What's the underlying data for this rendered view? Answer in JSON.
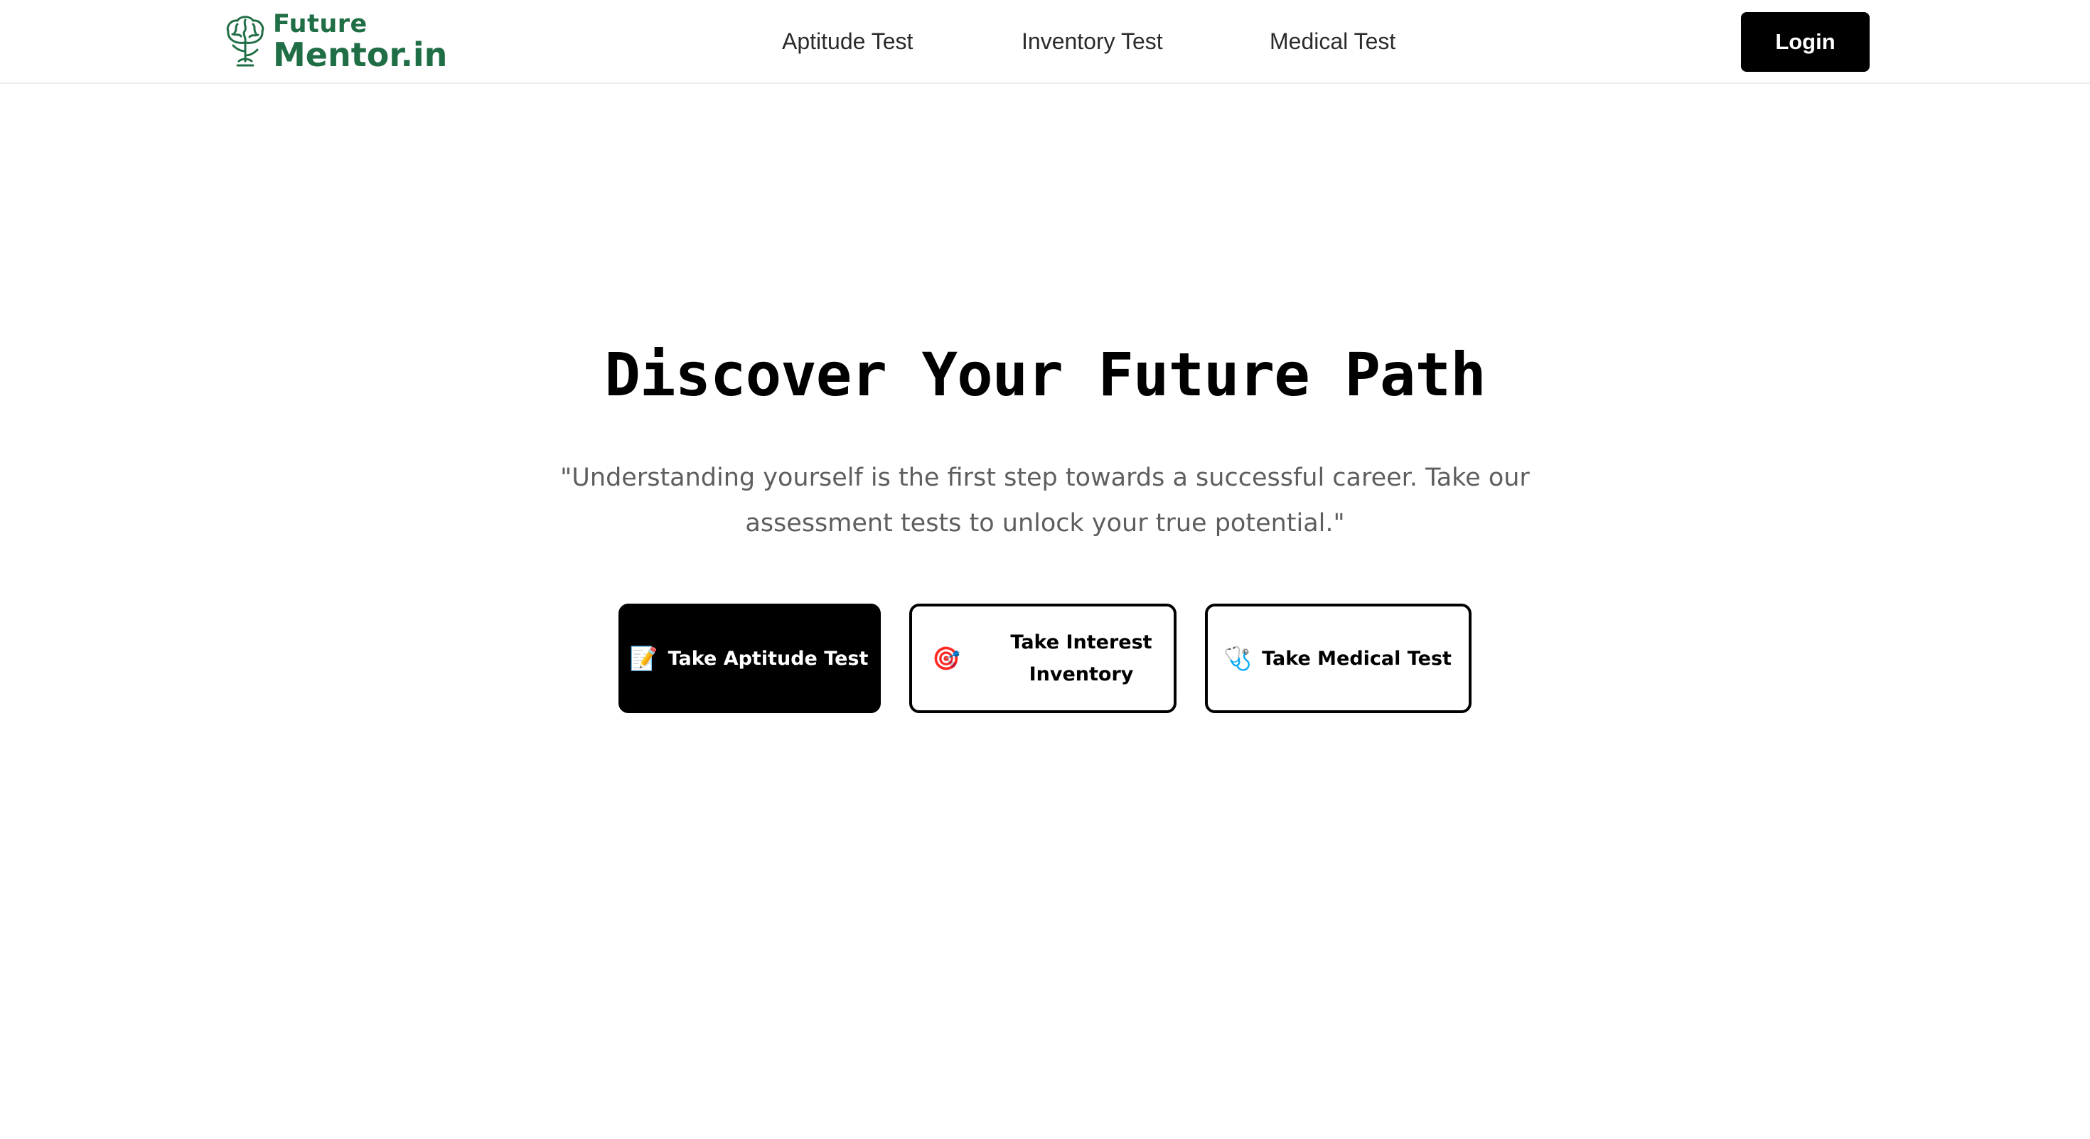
{
  "brand": {
    "top": "Future",
    "bottom": "Mentor.in",
    "color": "#1f6e45",
    "icon": "brain-tree-icon"
  },
  "nav": {
    "items": [
      {
        "label": "Aptitude Test"
      },
      {
        "label": "Inventory Test"
      },
      {
        "label": "Medical Test"
      }
    ],
    "login_label": "Login"
  },
  "hero": {
    "title": "Discover Your Future Path",
    "quote": "\"Understanding yourself is the first step towards a successful career. Take our assessment tests to unlock your true potential.\""
  },
  "cta": [
    {
      "label": "Take Aptitude Test",
      "icon": "memo-icon",
      "emoji": "📝"
    },
    {
      "label": "Take Interest Inventory",
      "icon": "target-icon",
      "emoji": "🎯"
    },
    {
      "label": "Take Medical Test",
      "icon": "stethoscope-icon",
      "emoji": "🩺"
    }
  ]
}
